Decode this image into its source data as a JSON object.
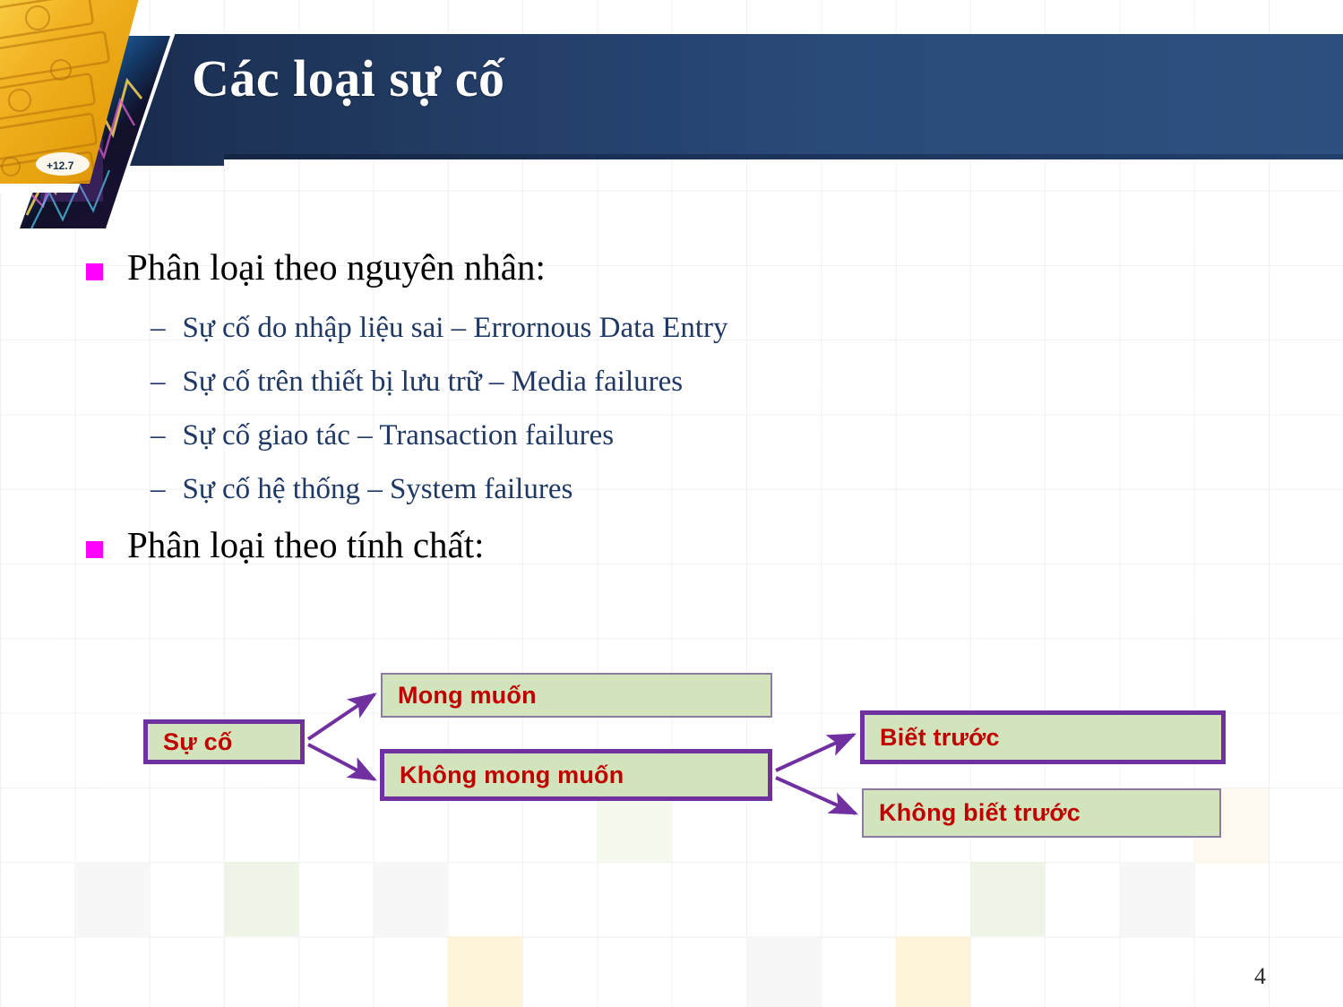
{
  "slide": {
    "title": "Các loại sự cố",
    "page_number": "4",
    "accent_colors": {
      "banner_dark": "#16294a",
      "banner_light": "#2e5080",
      "bullet_square": "#FF00FF",
      "level1_text": "#000000",
      "level2_text": "#1F3864",
      "node_fill": "#d2e4bc",
      "node_border_strong": "#7030A0",
      "node_border_light": "#8d7aa3",
      "node_text": "#C00000",
      "arrow": "#7030A0"
    }
  },
  "body": {
    "bullets": [
      {
        "label": "Phân loại theo nguyên nhân:",
        "sub_marker": "–",
        "sub_items": [
          "Sự cố do nhập liệu sai – Errornous Data Entry",
          "Sự cố trên thiết bị lưu trữ – Media failures",
          "Sự cố giao tác – Transaction failures",
          "Sự cố hệ thống – System failures"
        ]
      },
      {
        "label": "Phân loại theo tính chất:",
        "sub_marker": "–",
        "sub_items": []
      }
    ]
  },
  "diagram": {
    "nodes": [
      {
        "id": "su-co",
        "label": "Sự cố"
      },
      {
        "id": "mong-muon",
        "label": "Mong muốn"
      },
      {
        "id": "khong-mong-muon",
        "label": "Không mong muốn"
      },
      {
        "id": "biet-truoc",
        "label": "Biết trước"
      },
      {
        "id": "khong-biet-truoc",
        "label": "Không biết trước"
      }
    ],
    "edges": [
      {
        "from": "su-co",
        "to": "mong-muon"
      },
      {
        "from": "su-co",
        "to": "khong-mong-muon"
      },
      {
        "from": "khong-mong-muon",
        "to": "biet-truoc"
      },
      {
        "from": "khong-mong-muon",
        "to": "khong-biet-truoc"
      }
    ]
  }
}
